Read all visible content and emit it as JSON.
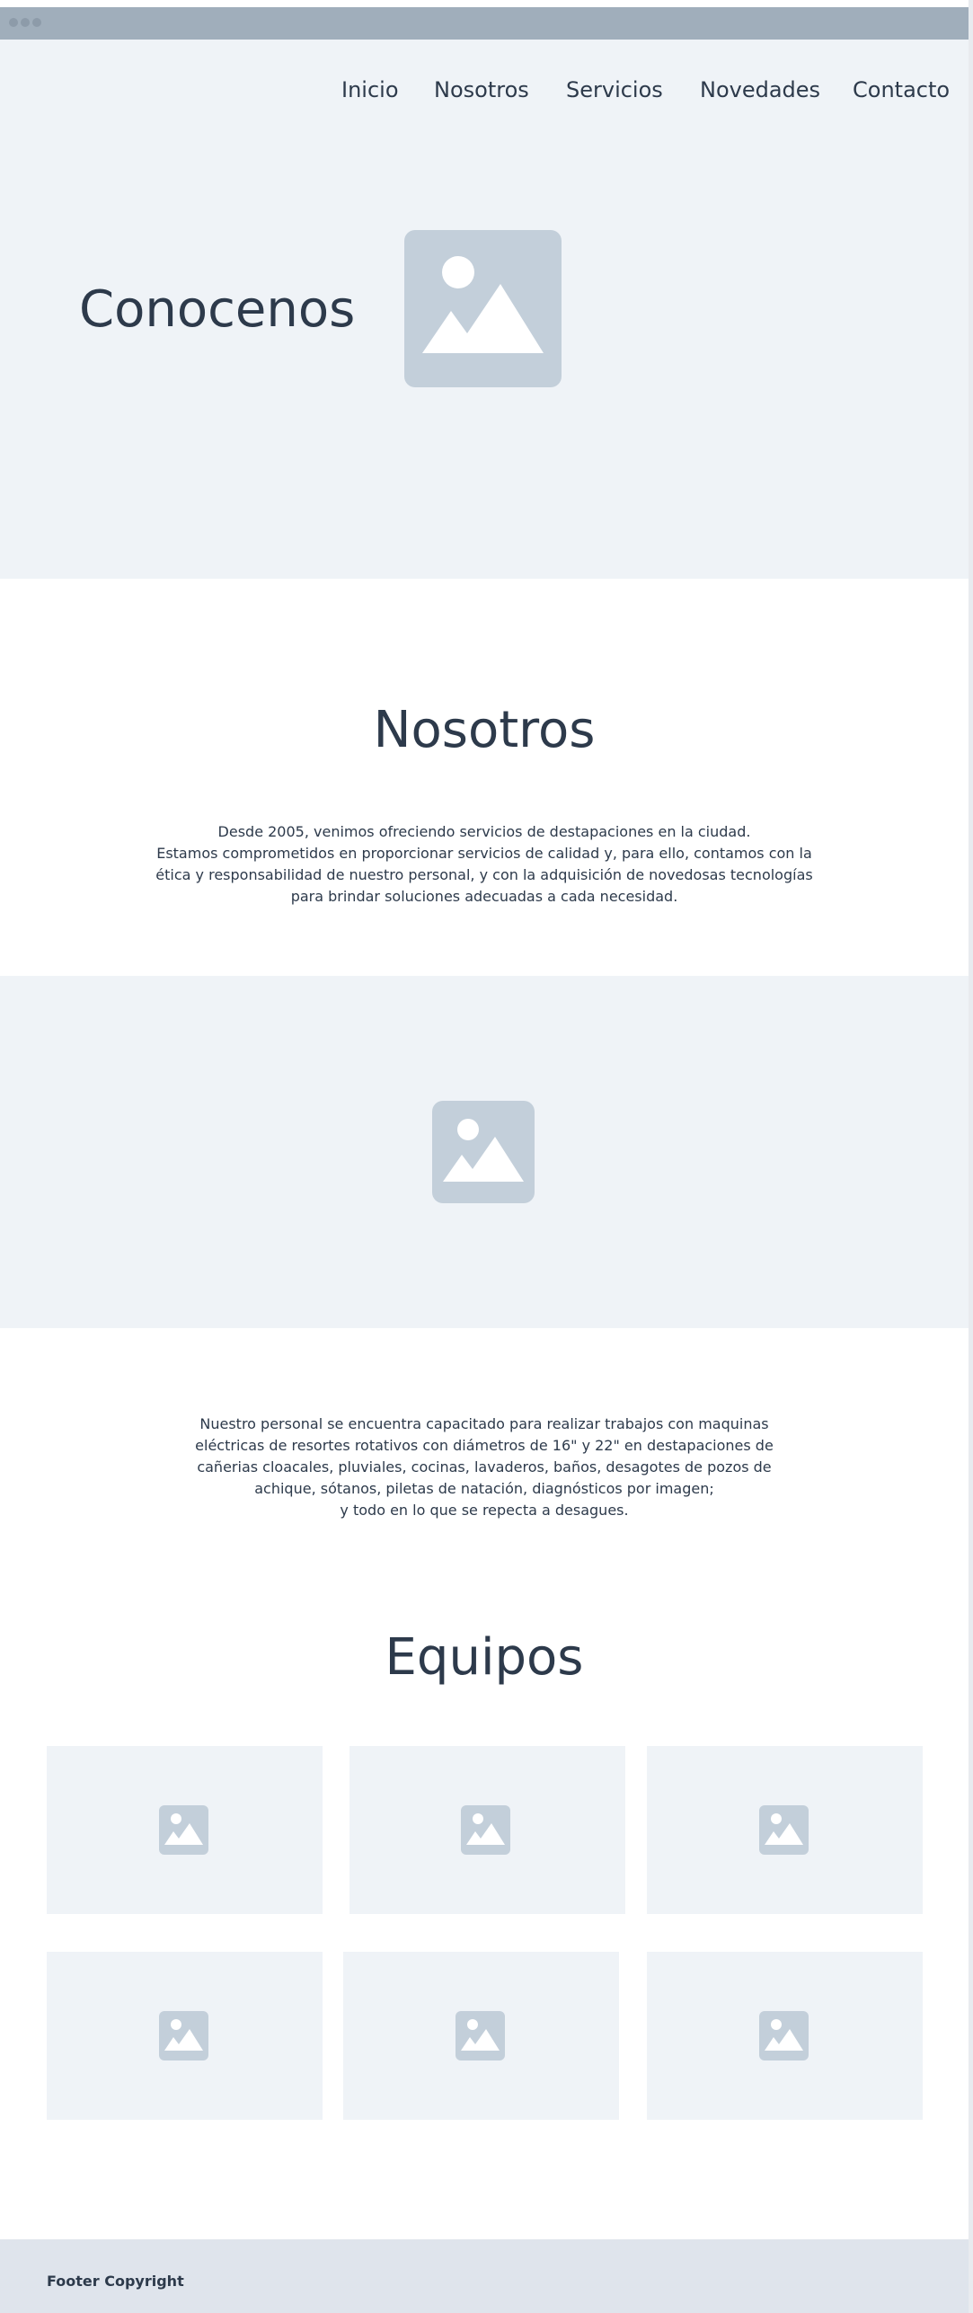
{
  "nav": {
    "items": [
      {
        "label": "Inicio"
      },
      {
        "label": "Nosotros"
      },
      {
        "label": "Servicios"
      },
      {
        "label": "Novedades"
      },
      {
        "label": "Contacto"
      }
    ]
  },
  "hero": {
    "title": "Conocenos",
    "image_icon": "image-placeholder-icon"
  },
  "about": {
    "title": "Nosotros",
    "lines": [
      "Desde 2005, venimos ofreciendo servicios de destapaciones en la ciudad.",
      "Estamos comprometidos en proporcionar servicios de calidad y, para ello, contamos con la",
      "ética y responsabilidad de nuestro personal, y con la adquisición de novedosas tecnologías",
      "para brindar soluciones adecuadas a cada necesidad."
    ]
  },
  "services": {
    "lines": [
      "Nuestro personal se encuentra capacitado para realizar trabajos con maquinas",
      "eléctricas de resortes rotativos con diámetros de 16\" y 22\" en destapaciones de",
      "cañerias cloacales, pluviales, cocinas, lavaderos, baños, desagotes de pozos de",
      "achique, sótanos, piletas de natación, diagnósticos por imagen;",
      "y todo en lo que se repecta a desagues."
    ]
  },
  "equipment": {
    "title": "Equipos",
    "card_count": 6
  },
  "footer": {
    "text": "Footer Copyright"
  },
  "colors": {
    "accent_text": "#2d3a4b",
    "placeholder": "#c3cfda",
    "section_bg": "#eff3f7",
    "footer_bg": "#dfe4ec",
    "titlebar": "#a0aebb"
  }
}
